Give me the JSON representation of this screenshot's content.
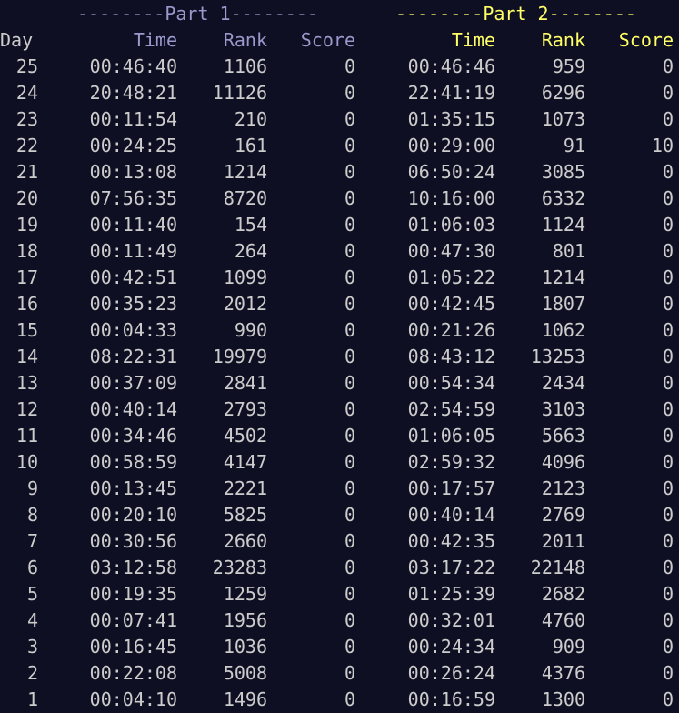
{
  "banners": {
    "part1": "--------Part 1--------",
    "part2": "--------Part 2--------"
  },
  "headers": {
    "day": "Day",
    "p1_time": "Time",
    "p1_rank": "Rank",
    "p1_score": "Score",
    "p2_time": "Time",
    "p2_rank": "Rank",
    "p2_score": "Score"
  },
  "colors": {
    "background": "#0f0f23",
    "text": "#cccccc",
    "part1": "#9999cc",
    "part2": "#ffff66"
  },
  "rows": [
    {
      "day": "25",
      "p1_time": "00:46:40",
      "p1_rank": "1106",
      "p1_score": "0",
      "p2_time": "00:46:46",
      "p2_rank": "959",
      "p2_score": "0"
    },
    {
      "day": "24",
      "p1_time": "20:48:21",
      "p1_rank": "11126",
      "p1_score": "0",
      "p2_time": "22:41:19",
      "p2_rank": "6296",
      "p2_score": "0"
    },
    {
      "day": "23",
      "p1_time": "00:11:54",
      "p1_rank": "210",
      "p1_score": "0",
      "p2_time": "01:35:15",
      "p2_rank": "1073",
      "p2_score": "0"
    },
    {
      "day": "22",
      "p1_time": "00:24:25",
      "p1_rank": "161",
      "p1_score": "0",
      "p2_time": "00:29:00",
      "p2_rank": "91",
      "p2_score": "10"
    },
    {
      "day": "21",
      "p1_time": "00:13:08",
      "p1_rank": "1214",
      "p1_score": "0",
      "p2_time": "06:50:24",
      "p2_rank": "3085",
      "p2_score": "0"
    },
    {
      "day": "20",
      "p1_time": "07:56:35",
      "p1_rank": "8720",
      "p1_score": "0",
      "p2_time": "10:16:00",
      "p2_rank": "6332",
      "p2_score": "0"
    },
    {
      "day": "19",
      "p1_time": "00:11:40",
      "p1_rank": "154",
      "p1_score": "0",
      "p2_time": "01:06:03",
      "p2_rank": "1124",
      "p2_score": "0"
    },
    {
      "day": "18",
      "p1_time": "00:11:49",
      "p1_rank": "264",
      "p1_score": "0",
      "p2_time": "00:47:30",
      "p2_rank": "801",
      "p2_score": "0"
    },
    {
      "day": "17",
      "p1_time": "00:42:51",
      "p1_rank": "1099",
      "p1_score": "0",
      "p2_time": "01:05:22",
      "p2_rank": "1214",
      "p2_score": "0"
    },
    {
      "day": "16",
      "p1_time": "00:35:23",
      "p1_rank": "2012",
      "p1_score": "0",
      "p2_time": "00:42:45",
      "p2_rank": "1807",
      "p2_score": "0"
    },
    {
      "day": "15",
      "p1_time": "00:04:33",
      "p1_rank": "990",
      "p1_score": "0",
      "p2_time": "00:21:26",
      "p2_rank": "1062",
      "p2_score": "0"
    },
    {
      "day": "14",
      "p1_time": "08:22:31",
      "p1_rank": "19979",
      "p1_score": "0",
      "p2_time": "08:43:12",
      "p2_rank": "13253",
      "p2_score": "0"
    },
    {
      "day": "13",
      "p1_time": "00:37:09",
      "p1_rank": "2841",
      "p1_score": "0",
      "p2_time": "00:54:34",
      "p2_rank": "2434",
      "p2_score": "0"
    },
    {
      "day": "12",
      "p1_time": "00:40:14",
      "p1_rank": "2793",
      "p1_score": "0",
      "p2_time": "02:54:59",
      "p2_rank": "3103",
      "p2_score": "0"
    },
    {
      "day": "11",
      "p1_time": "00:34:46",
      "p1_rank": "4502",
      "p1_score": "0",
      "p2_time": "01:06:05",
      "p2_rank": "5663",
      "p2_score": "0"
    },
    {
      "day": "10",
      "p1_time": "00:58:59",
      "p1_rank": "4147",
      "p1_score": "0",
      "p2_time": "02:59:32",
      "p2_rank": "4096",
      "p2_score": "0"
    },
    {
      "day": "9",
      "p1_time": "00:13:45",
      "p1_rank": "2221",
      "p1_score": "0",
      "p2_time": "00:17:57",
      "p2_rank": "2123",
      "p2_score": "0"
    },
    {
      "day": "8",
      "p1_time": "00:20:10",
      "p1_rank": "5825",
      "p1_score": "0",
      "p2_time": "00:40:14",
      "p2_rank": "2769",
      "p2_score": "0"
    },
    {
      "day": "7",
      "p1_time": "00:30:56",
      "p1_rank": "2660",
      "p1_score": "0",
      "p2_time": "00:42:35",
      "p2_rank": "2011",
      "p2_score": "0"
    },
    {
      "day": "6",
      "p1_time": "03:12:58",
      "p1_rank": "23283",
      "p1_score": "0",
      "p2_time": "03:17:22",
      "p2_rank": "22148",
      "p2_score": "0"
    },
    {
      "day": "5",
      "p1_time": "00:19:35",
      "p1_rank": "1259",
      "p1_score": "0",
      "p2_time": "01:25:39",
      "p2_rank": "2682",
      "p2_score": "0"
    },
    {
      "day": "4",
      "p1_time": "00:07:41",
      "p1_rank": "1956",
      "p1_score": "0",
      "p2_time": "00:32:01",
      "p2_rank": "4760",
      "p2_score": "0"
    },
    {
      "day": "3",
      "p1_time": "00:16:45",
      "p1_rank": "1036",
      "p1_score": "0",
      "p2_time": "00:24:34",
      "p2_rank": "909",
      "p2_score": "0"
    },
    {
      "day": "2",
      "p1_time": "00:22:08",
      "p1_rank": "5008",
      "p1_score": "0",
      "p2_time": "00:26:24",
      "p2_rank": "4376",
      "p2_score": "0"
    },
    {
      "day": "1",
      "p1_time": "00:04:10",
      "p1_rank": "1496",
      "p1_score": "0",
      "p2_time": "00:16:59",
      "p2_rank": "1300",
      "p2_score": "0"
    }
  ]
}
